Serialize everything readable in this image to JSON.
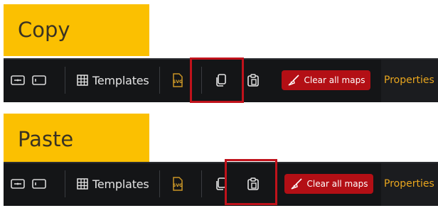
{
  "panels": [
    {
      "label": "Copy",
      "highlighted_tool": "copy"
    },
    {
      "label": "Paste",
      "highlighted_tool": "paste"
    }
  ],
  "toolbar": {
    "templates_label": "Templates",
    "clear_label": "Clear all maps",
    "properties_label": "Properties",
    "svg_badge": "SVG"
  },
  "colors": {
    "label_bg": "#fbc001",
    "toolbar_bg": "#141517",
    "clear_bg": "#b30f15",
    "highlight": "#c0121b",
    "properties_text": "#e9a61e"
  },
  "icons": {
    "toggle_1": "toggle-icon",
    "toggle_2": "panel-toggle-icon",
    "templates": "grid-icon",
    "export": "svg-export-icon",
    "copy": "copy-icon",
    "paste": "paste-icon",
    "clear": "broom-icon"
  }
}
